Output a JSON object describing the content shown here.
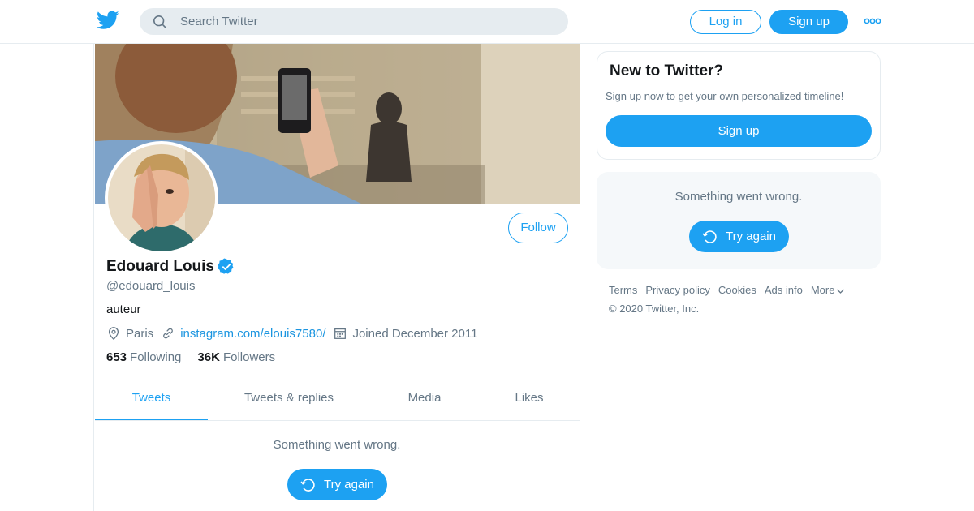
{
  "header": {
    "search_placeholder": "Search Twitter",
    "login_label": "Log in",
    "signup_label": "Sign up"
  },
  "profile": {
    "name": "Edouard Louis",
    "verified": true,
    "handle": "@edouard_louis",
    "bio": "auteur",
    "location": "Paris",
    "website": "instagram.com/elouis7580/",
    "joined": "Joined December 2011",
    "following_count": "653",
    "following_label": "Following",
    "followers_count": "36K",
    "followers_label": "Followers",
    "follow_label": "Follow"
  },
  "tabs": [
    {
      "label": "Tweets",
      "active": true
    },
    {
      "label": "Tweets & replies",
      "active": false
    },
    {
      "label": "Media",
      "active": false
    },
    {
      "label": "Likes",
      "active": false
    }
  ],
  "timeline": {
    "error_text": "Something went wrong.",
    "retry_label": "Try again"
  },
  "sidebar": {
    "new_title": "New to Twitter?",
    "new_text": "Sign up now to get your own personalized timeline!",
    "signup_label": "Sign up",
    "error_text": "Something went wrong.",
    "retry_label": "Try again"
  },
  "footer": {
    "links": [
      "Terms",
      "Privacy policy",
      "Cookies",
      "Ads info",
      "More"
    ],
    "copyright": "© 2020 Twitter, Inc."
  },
  "colors": {
    "accent": "#1da1f2",
    "link": "#1b95e0",
    "secondary_text": "#657786",
    "border": "#e6ecf0"
  }
}
